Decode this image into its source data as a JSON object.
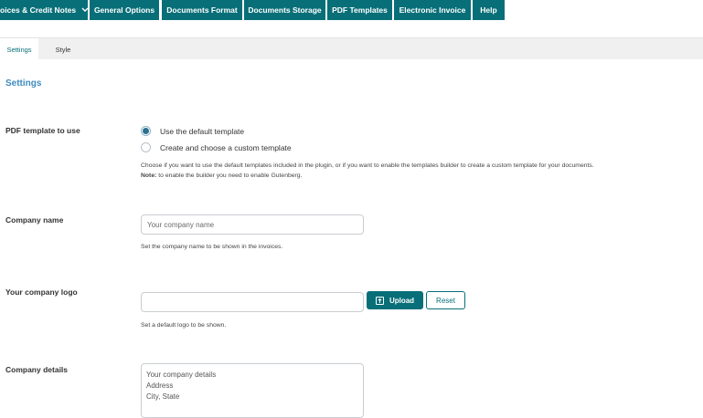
{
  "topnav": {
    "tabs": [
      {
        "label": "oices & Credit Notes",
        "has_dropdown": true
      },
      {
        "label": "General Options"
      },
      {
        "label": "Documents Format"
      },
      {
        "label": "Documents Storage"
      },
      {
        "label": "PDF Templates"
      },
      {
        "label": "Electronic Invoice"
      },
      {
        "label": "Help"
      }
    ]
  },
  "subtabs": [
    {
      "label": "Settings",
      "active": true
    },
    {
      "label": "Style",
      "active": false
    }
  ],
  "section_title": "Settings",
  "pdf_template": {
    "label": "PDF template to use",
    "options": [
      {
        "label": "Use the default template",
        "checked": true
      },
      {
        "label": "Create and choose a custom template",
        "checked": false
      }
    ],
    "description": "Choose if you want to use the default templates included in the plugin, or if you want to enable the templates builder to create a custom template for your documents.",
    "note_prefix": "Note:",
    "note_text": " to enable the builder you need to enable Gutenberg."
  },
  "company_name": {
    "label": "Company name",
    "placeholder": "Your company name",
    "value": "",
    "description": "Set the company name to be shown in the invoices."
  },
  "company_logo": {
    "label": "Your company logo",
    "value": "",
    "upload_label": "Upload",
    "reset_label": "Reset",
    "description": "Set a default logo to be shown."
  },
  "company_details": {
    "label": "Company details",
    "value": "Your company details\nAddress\nCity, State"
  },
  "colors": {
    "accent": "#086f78",
    "section_title": "#3e8bbf"
  }
}
